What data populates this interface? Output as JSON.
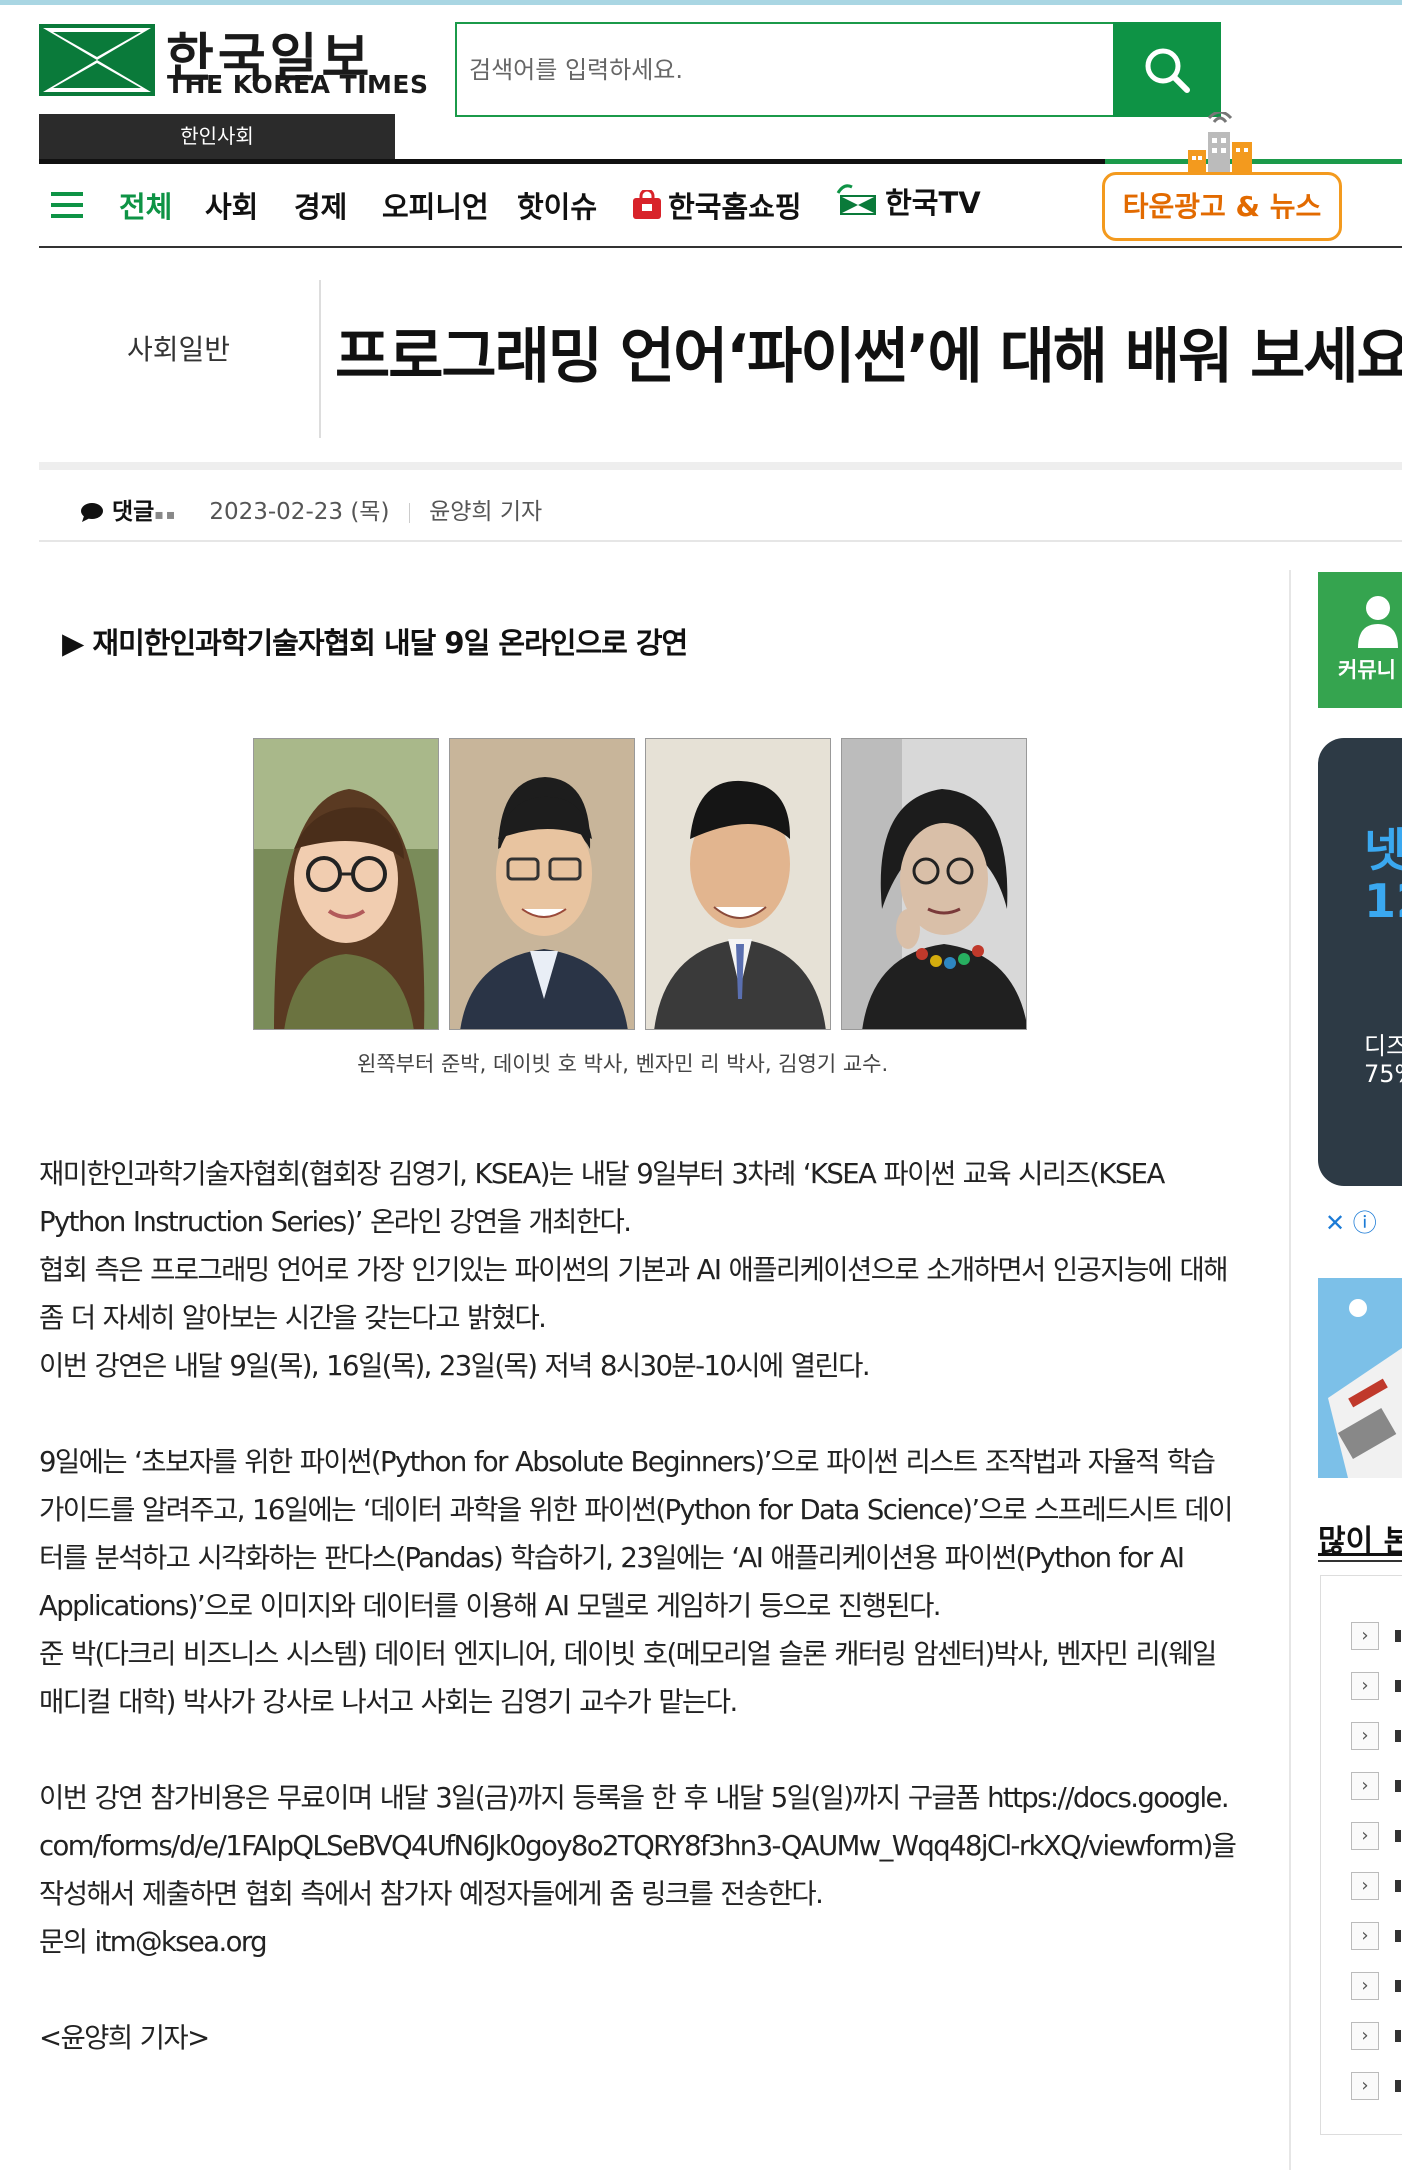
{
  "header": {
    "logo_korean": "한국일보",
    "logo_english": "THE KOREA TIMES",
    "section_tag": "한인사회",
    "search_placeholder": "검색어를 입력하세요."
  },
  "nav": {
    "items": [
      {
        "label": "전체",
        "active": true
      },
      {
        "label": "사회"
      },
      {
        "label": "경제"
      },
      {
        "label": "오피니언"
      },
      {
        "label": "핫이슈"
      },
      {
        "label": "한국홈쇼핑"
      },
      {
        "label": "한국TV"
      }
    ],
    "town_button": "타운광고 & 뉴스"
  },
  "article": {
    "category": "사회일반",
    "title": "프로그래밍 언어‘파이썬’에 대해 배워 보세요",
    "comment_label": "댓글",
    "date": "2023-02-23 (목)",
    "author": "윤양희 기자",
    "subhead": "▶ 재미한인과학기술자협회 내달 9일 온라인으로 강연",
    "photo_caption": "왼쪽부터 준박, 데이빗 호 박사, 벤자민 리 박사, 김영기 교수.",
    "paragraphs": [
      "재미한인과학기술자협회(협회장 김영기, KSEA)는 내달 9일부터 3차례 ‘KSEA 파이썬 교육 시리즈(KSEA Python Instruction Series)’ 온라인 강연을 개최한다.",
      "협회 측은 프로그래밍 언어로 가장 인기있는 파이썬의 기본과 AI 애플리케이션으로 소개하면서 인공지능에 대해 좀 더 자세히 알아보는 시간을 갖는다고 밝혔다.",
      "이번 강연은 내달 9일(목), 16일(목), 23일(목) 저녁 8시30분-10시에 열린다.",
      "",
      "9일에는 ‘초보자를 위한 파이썬(Python for Absolute Beginners)’으로 파이썬 리스트 조작법과 자율적 학습 가이드를 알려주고, 16일에는 ‘데이터 과학을 위한 파이썬(Python for Data Science)’으로 스프레드시트 데이터를 분석하고 시각화하는 판다스(Pandas) 학습하기, 23일에는 ‘AI 애플리케이션용 파이썬(Python for AI Applications)’으로 이미지와 데이터를 이용해 AI 모델로 게임하기 등으로 진행된다.",
      "준 박(다크리 비즈니스 시스템) 데이터 엔지니어, 데이빗 호(메모리얼 슬론 캐터링 암센터)박사, 벤자민 리(웨일 매디컬 대학) 박사가 강사로 나서고 사회는 김영기 교수가 맡는다.",
      "",
      "이번 강연 참가비용은 무료이며 내달 3일(금)까지 등록을 한 후 내달 5일(일)까지 구글폼 https://docs.google.com/forms/d/e/1FAIpQLSeBVQ4UfN6Jk0goy8o2TQRY8f3hn3-QAUMw_Wqq48jCl-rkXQ/viewform)을 작성해서 제출하면 협회 측에서 참가자 예정자들에게 줌 링크를 전송한다.",
      "문의 itm@ksea.org",
      "",
      "<윤양희 기자>"
    ]
  },
  "sidebar": {
    "community_label": "커뮤니",
    "ad_line1": "넷",
    "ad_line2": "12",
    "ad_line3": "디즈",
    "ad_line4": "75%",
    "ad_controls": "✕ ⓘ",
    "popular_title": "많이 본"
  },
  "colors": {
    "brand_green": "#0e9345",
    "town_orange": "#f39a1e"
  }
}
